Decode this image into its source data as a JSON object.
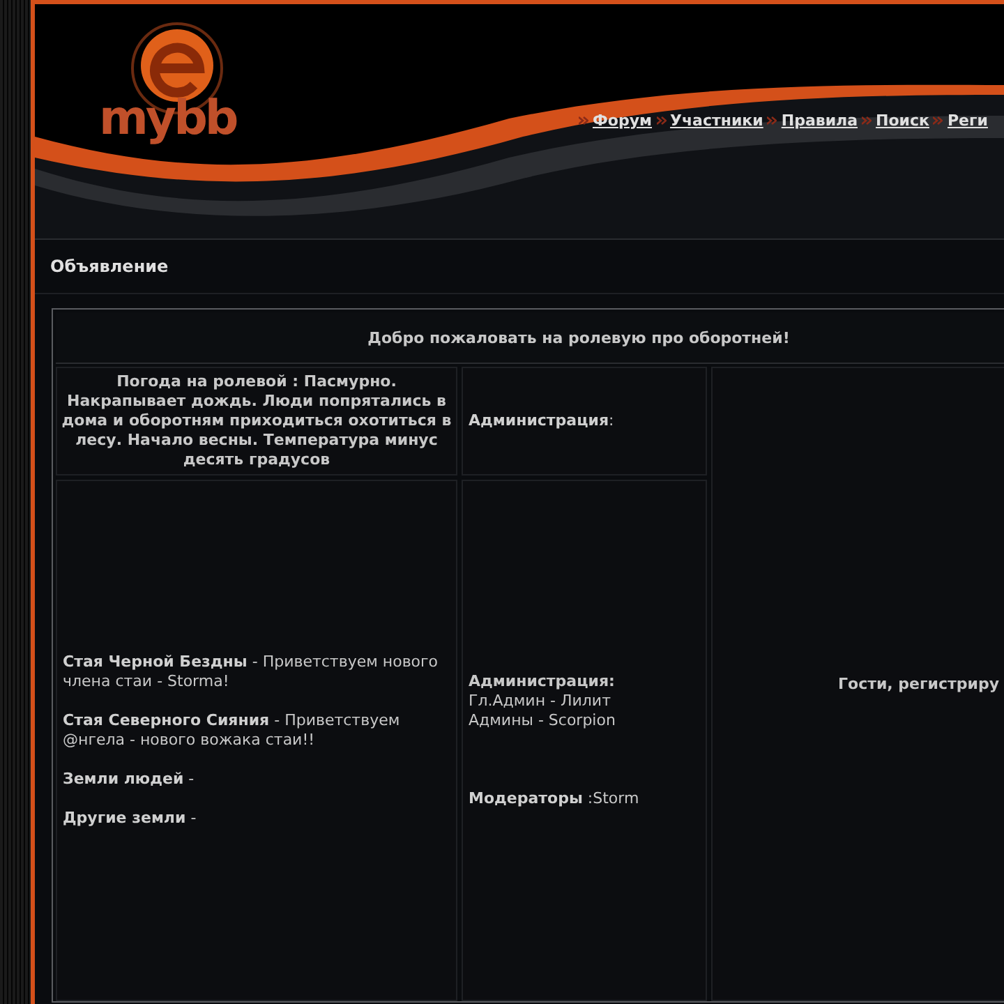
{
  "header": {
    "logo_text": "mybb",
    "nav": [
      {
        "label": "Форум"
      },
      {
        "label": "Участники"
      },
      {
        "label": "Правила"
      },
      {
        "label": "Поиск"
      },
      {
        "label": "Реги"
      }
    ]
  },
  "announcement": {
    "title": "Объявление",
    "welcome": "Добро пожаловать на ролевую про оборотней!",
    "weather": "Погода на ролевой : Пасмурно. Накрапывает дождь. Люди попрятались в дома и оборотням приходиться охотиться в лесу. Начало весны. Температура минус десять градусов",
    "admin_heading": "**Администрация**:",
    "packs": [
      "**Стая Черной Бездны** - Приветствуем нового члена стаи - Storma!",
      "**Стая Северного Сияния** - Приветствуем @нгела - нового вожака стаи!!",
      "**Земли людей** -",
      "**Другие земли** -"
    ],
    "staff": [
      {
        "kind": "heading",
        "text": "Администрация:"
      },
      {
        "kind": "line",
        "text": "Гл.Админ - Лилит"
      },
      {
        "kind": "line",
        "text": "Админы - Scorpion"
      },
      {
        "kind": "gap"
      },
      {
        "kind": "line",
        "text": "**Модераторы** :Storm"
      }
    ],
    "guests": "Гости, регистриру"
  }
}
